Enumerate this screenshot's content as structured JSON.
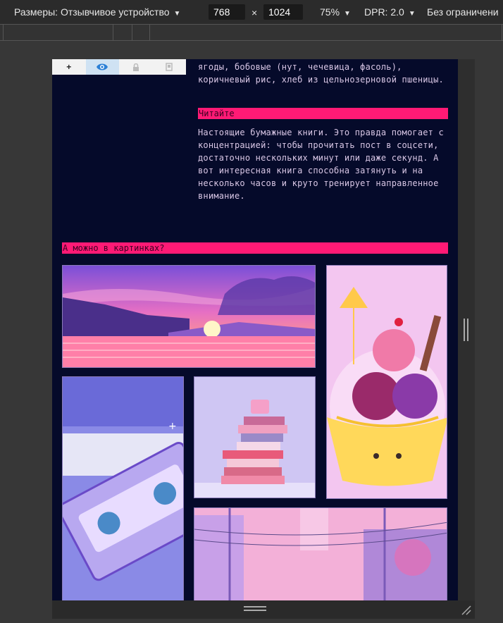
{
  "toolbar": {
    "device_label": "Размеры: Отзывчивое устройство",
    "width_value": "768",
    "height_value": "1024",
    "times": "×",
    "zoom": "75%",
    "dpr": "DPR: 2.0",
    "throttle": "Без ограничени"
  },
  "floatbar": {
    "add": "+"
  },
  "content": {
    "para1": "ягоды, бобовые (нут, чечевица, фасоль), коричневый рис, хлеб из цельнозерновой пшеницы.",
    "heading_read": "Читайте",
    "para2": "Настоящие бумажные книги. Это правда помогает с концентрацией: чтобы прочитать пост в соцсети, достаточно нескольких минут или даже секунд. А вот интересная книга способна затянуть и на несколько часов и круто тренирует направленное внимание.",
    "heading_pictures": "А можно в картинках?"
  },
  "colors": {
    "accent_pink": "#ff1a75",
    "page_bg": "#050a2a",
    "text": "#d9c7e6"
  },
  "icons": [
    "add-icon",
    "eye-icon",
    "lock-icon",
    "device-icon",
    "resize-handle-icon",
    "corner-grip-icon"
  ]
}
